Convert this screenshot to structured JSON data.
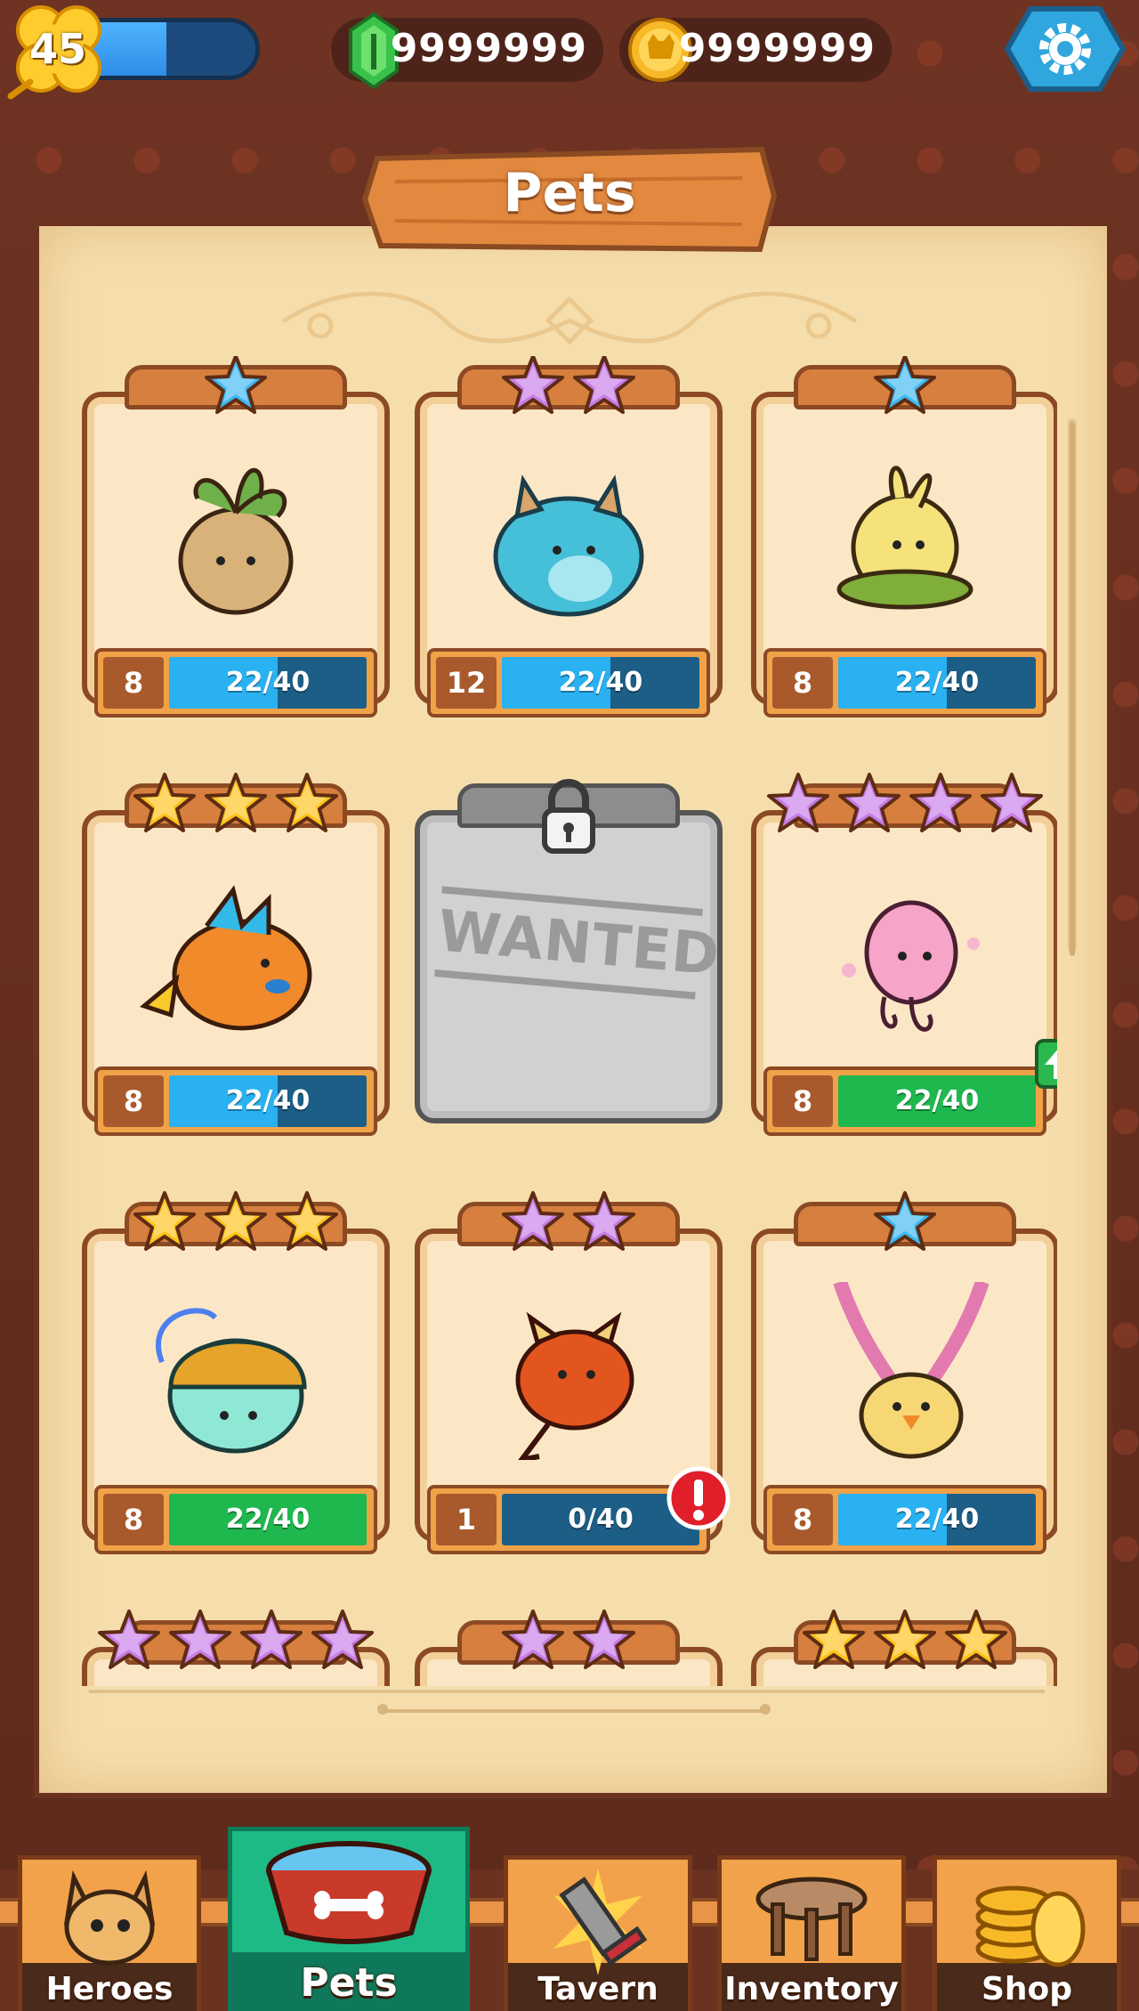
{
  "hud": {
    "level": "45",
    "level_progress": 0.55,
    "gems": "9999999",
    "coins": "9999999"
  },
  "title": "Pets",
  "cards": [
    {
      "stars": 1,
      "star_color": "blue",
      "level": "8",
      "xp": "22/40",
      "xp_fill": 0.55,
      "bar": "blue",
      "pet": "onion-sprout-pet"
    },
    {
      "stars": 2,
      "star_color": "purple",
      "level": "12",
      "xp": "22/40",
      "xp_fill": 0.55,
      "bar": "blue",
      "pet": "blue-horned-beast-pet"
    },
    {
      "stars": 1,
      "star_color": "blue",
      "level": "8",
      "xp": "22/40",
      "xp_fill": 0.55,
      "bar": "blue",
      "pet": "leaf-skirt-chick-pet"
    },
    {
      "stars": 3,
      "star_color": "gold",
      "level": "8",
      "xp": "22/40",
      "xp_fill": 0.55,
      "bar": "blue",
      "pet": "orange-fish-pet"
    },
    {
      "locked": true,
      "label": "WANTED"
    },
    {
      "stars": 4,
      "star_color": "purple",
      "level": "8",
      "xp": "22/40",
      "xp_fill": 1.0,
      "bar": "green",
      "pet": "pink-jellyfish-pet",
      "upgrade": true
    },
    {
      "stars": 3,
      "star_color": "gold",
      "level": "8",
      "xp": "22/40",
      "xp_fill": 1.0,
      "bar": "green",
      "pet": "helmet-slime-pet"
    },
    {
      "stars": 2,
      "star_color": "purple",
      "level": "1",
      "xp": "0/40",
      "xp_fill": 0.0,
      "bar": "blue",
      "pet": "red-imp-pet",
      "alert": true
    },
    {
      "stars": 1,
      "star_color": "blue",
      "level": "8",
      "xp": "22/40",
      "xp_fill": 0.55,
      "bar": "blue",
      "pet": "long-ear-chick-pet"
    },
    {
      "stars": 4,
      "star_color": "purple",
      "partial": true
    },
    {
      "stars": 2,
      "star_color": "purple",
      "partial": true
    },
    {
      "stars": 3,
      "star_color": "gold",
      "partial": true
    }
  ],
  "nav": [
    {
      "label": "Heroes",
      "icon": "cat-hero-icon"
    },
    {
      "label": "Pets",
      "icon": "pet-bowl-icon",
      "active": true
    },
    {
      "label": "Tavern",
      "icon": "sword-icon"
    },
    {
      "label": "Inventory",
      "icon": "table-icon"
    },
    {
      "label": "Shop",
      "icon": "coin-stack-icon"
    }
  ],
  "colors": {
    "blue_star": "#3db8f0",
    "purple_star": "#c77be6",
    "gold_star": "#ffc21a",
    "xp_blue": "#2ab1f2",
    "xp_green": "#1fb84f",
    "nav_active": "#1dba85"
  }
}
